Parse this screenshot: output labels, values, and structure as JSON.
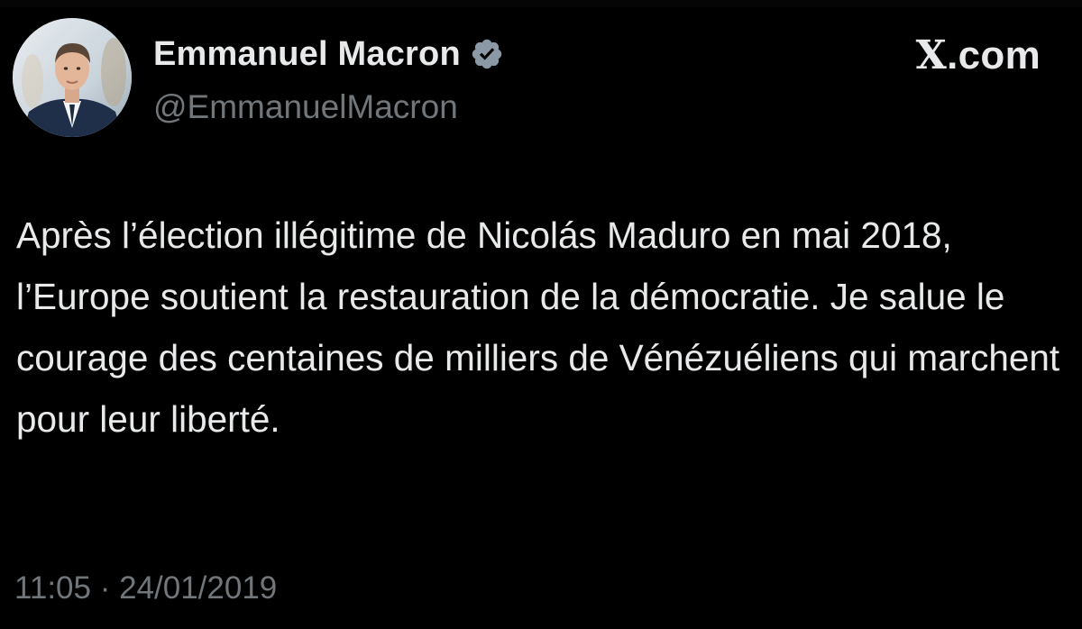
{
  "author": {
    "display_name": "Emmanuel Macron",
    "handle": "@EmmanuelMacron",
    "verified_badge_icon": "verified-badge-icon",
    "verified_badge_color": "#8b98a5",
    "avatar_icon": "profile-photo"
  },
  "brand": {
    "x_glyph": "X",
    "suffix": ".com"
  },
  "tweet": {
    "text": "Après l’élection illégitime de Nicolás Maduro en mai 2018, l’Europe soutient la restauration de la démocratie. Je salue le courage des centaines de milliers de Vénézuéliens qui marchent pour leur liberté.",
    "timestamp": "11:05 · 24/01/2019"
  },
  "colors": {
    "background": "#000000",
    "primary_text": "#e7e9ea",
    "secondary_text": "#71767b"
  }
}
